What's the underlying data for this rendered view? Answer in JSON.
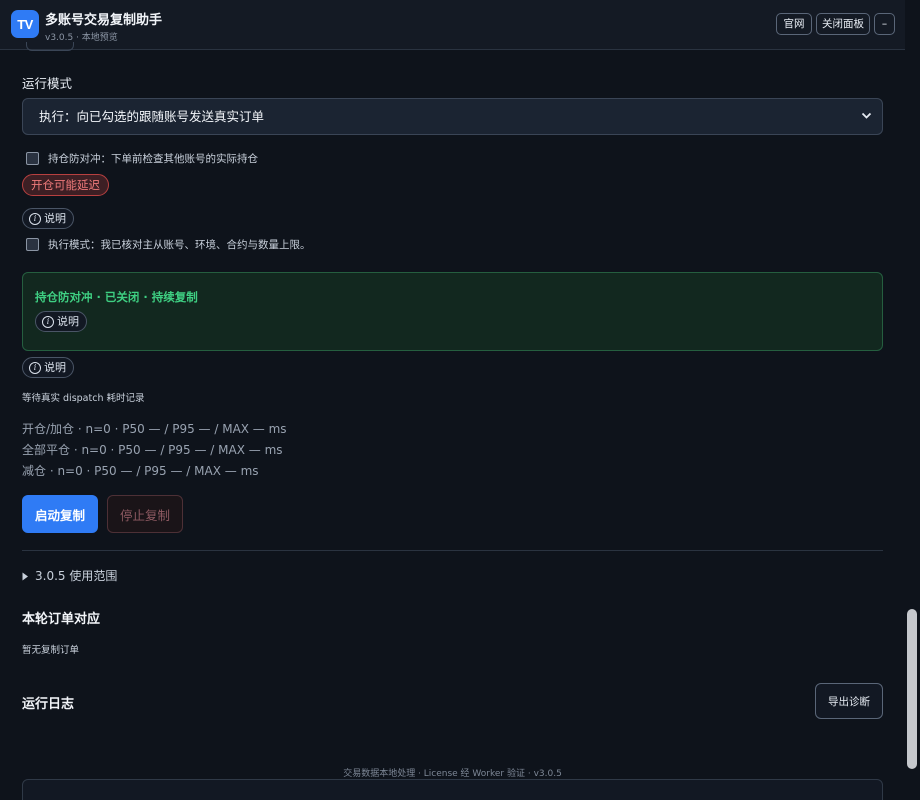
{
  "header": {
    "logo_text": "TV",
    "title": "多账号交易复制助手",
    "subtitle": "v3.0.5 · 本地预览",
    "btn_site": "官网",
    "btn_close_panel": "关闭面板",
    "btn_minimize": "–"
  },
  "run_mode": {
    "label": "运行模式",
    "selected": "执行：向已勾选的跟随账号发送真实订单",
    "anti_hedge_check": "持仓防对冲：下单前检查其他账号的实际持仓",
    "warn_badge": "开仓可能延迟",
    "info_label": "说明",
    "exec_confirm_check": "执行模式：我已核对主从账号、环境、合约与数量上限。"
  },
  "status_box": {
    "title": "持仓防对冲 · 已关闭 · 持续复制",
    "info_label": "说明"
  },
  "latency": {
    "info_label": "说明",
    "waiting": "等待真实 dispatch 耗时记录",
    "rows": [
      "开仓/加仓 · n=0 · P50 — / P95 — / MAX — ms",
      "全部平仓 · n=0 · P50 — / P95 — / MAX — ms",
      "减仓 · n=0 · P50 — / P95 — / MAX — ms"
    ]
  },
  "actions": {
    "start": "启动复制",
    "stop": "停止复制"
  },
  "scope": {
    "toggle": "3.0.5 使用范围"
  },
  "orders": {
    "title": "本轮订单对应",
    "empty": "暂无复制订单"
  },
  "log": {
    "title": "运行日志",
    "export": "导出诊断"
  },
  "footer": {
    "note": "交易数据本地处理 · License 经 Worker 验证 · v3.0.5"
  },
  "colors": {
    "accent": "#2f7bf5",
    "success": "#3ecf82",
    "danger": "#f07b7b",
    "background": "#0e131b"
  }
}
